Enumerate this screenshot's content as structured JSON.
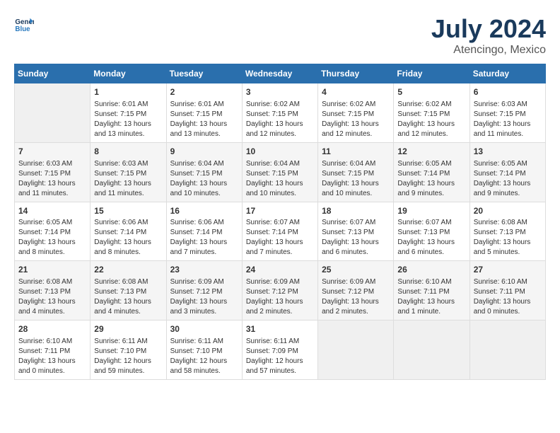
{
  "logo": {
    "line1": "General",
    "line2": "Blue"
  },
  "title": "July 2024",
  "subtitle": "Atencingo, Mexico",
  "days_of_week": [
    "Sunday",
    "Monday",
    "Tuesday",
    "Wednesday",
    "Thursday",
    "Friday",
    "Saturday"
  ],
  "weeks": [
    [
      {
        "day": "",
        "empty": true
      },
      {
        "day": "1",
        "sunrise": "6:01 AM",
        "sunset": "7:15 PM",
        "daylight": "13 hours and 13 minutes."
      },
      {
        "day": "2",
        "sunrise": "6:01 AM",
        "sunset": "7:15 PM",
        "daylight": "13 hours and 13 minutes."
      },
      {
        "day": "3",
        "sunrise": "6:02 AM",
        "sunset": "7:15 PM",
        "daylight": "13 hours and 12 minutes."
      },
      {
        "day": "4",
        "sunrise": "6:02 AM",
        "sunset": "7:15 PM",
        "daylight": "13 hours and 12 minutes."
      },
      {
        "day": "5",
        "sunrise": "6:02 AM",
        "sunset": "7:15 PM",
        "daylight": "13 hours and 12 minutes."
      },
      {
        "day": "6",
        "sunrise": "6:03 AM",
        "sunset": "7:15 PM",
        "daylight": "13 hours and 11 minutes."
      }
    ],
    [
      {
        "day": "7",
        "sunrise": "6:03 AM",
        "sunset": "7:15 PM",
        "daylight": "13 hours and 11 minutes."
      },
      {
        "day": "8",
        "sunrise": "6:03 AM",
        "sunset": "7:15 PM",
        "daylight": "13 hours and 11 minutes."
      },
      {
        "day": "9",
        "sunrise": "6:04 AM",
        "sunset": "7:15 PM",
        "daylight": "13 hours and 10 minutes."
      },
      {
        "day": "10",
        "sunrise": "6:04 AM",
        "sunset": "7:15 PM",
        "daylight": "13 hours and 10 minutes."
      },
      {
        "day": "11",
        "sunrise": "6:04 AM",
        "sunset": "7:15 PM",
        "daylight": "13 hours and 10 minutes."
      },
      {
        "day": "12",
        "sunrise": "6:05 AM",
        "sunset": "7:14 PM",
        "daylight": "13 hours and 9 minutes."
      },
      {
        "day": "13",
        "sunrise": "6:05 AM",
        "sunset": "7:14 PM",
        "daylight": "13 hours and 9 minutes."
      }
    ],
    [
      {
        "day": "14",
        "sunrise": "6:05 AM",
        "sunset": "7:14 PM",
        "daylight": "13 hours and 8 minutes."
      },
      {
        "day": "15",
        "sunrise": "6:06 AM",
        "sunset": "7:14 PM",
        "daylight": "13 hours and 8 minutes."
      },
      {
        "day": "16",
        "sunrise": "6:06 AM",
        "sunset": "7:14 PM",
        "daylight": "13 hours and 7 minutes."
      },
      {
        "day": "17",
        "sunrise": "6:07 AM",
        "sunset": "7:14 PM",
        "daylight": "13 hours and 7 minutes."
      },
      {
        "day": "18",
        "sunrise": "6:07 AM",
        "sunset": "7:13 PM",
        "daylight": "13 hours and 6 minutes."
      },
      {
        "day": "19",
        "sunrise": "6:07 AM",
        "sunset": "7:13 PM",
        "daylight": "13 hours and 6 minutes."
      },
      {
        "day": "20",
        "sunrise": "6:08 AM",
        "sunset": "7:13 PM",
        "daylight": "13 hours and 5 minutes."
      }
    ],
    [
      {
        "day": "21",
        "sunrise": "6:08 AM",
        "sunset": "7:13 PM",
        "daylight": "13 hours and 4 minutes."
      },
      {
        "day": "22",
        "sunrise": "6:08 AM",
        "sunset": "7:13 PM",
        "daylight": "13 hours and 4 minutes."
      },
      {
        "day": "23",
        "sunrise": "6:09 AM",
        "sunset": "7:12 PM",
        "daylight": "13 hours and 3 minutes."
      },
      {
        "day": "24",
        "sunrise": "6:09 AM",
        "sunset": "7:12 PM",
        "daylight": "13 hours and 2 minutes."
      },
      {
        "day": "25",
        "sunrise": "6:09 AM",
        "sunset": "7:12 PM",
        "daylight": "13 hours and 2 minutes."
      },
      {
        "day": "26",
        "sunrise": "6:10 AM",
        "sunset": "7:11 PM",
        "daylight": "13 hours and 1 minute."
      },
      {
        "day": "27",
        "sunrise": "6:10 AM",
        "sunset": "7:11 PM",
        "daylight": "13 hours and 0 minutes."
      }
    ],
    [
      {
        "day": "28",
        "sunrise": "6:10 AM",
        "sunset": "7:11 PM",
        "daylight": "13 hours and 0 minutes."
      },
      {
        "day": "29",
        "sunrise": "6:11 AM",
        "sunset": "7:10 PM",
        "daylight": "12 hours and 59 minutes."
      },
      {
        "day": "30",
        "sunrise": "6:11 AM",
        "sunset": "7:10 PM",
        "daylight": "12 hours and 58 minutes."
      },
      {
        "day": "31",
        "sunrise": "6:11 AM",
        "sunset": "7:09 PM",
        "daylight": "12 hours and 57 minutes."
      },
      {
        "day": "",
        "empty": true
      },
      {
        "day": "",
        "empty": true
      },
      {
        "day": "",
        "empty": true
      }
    ]
  ]
}
